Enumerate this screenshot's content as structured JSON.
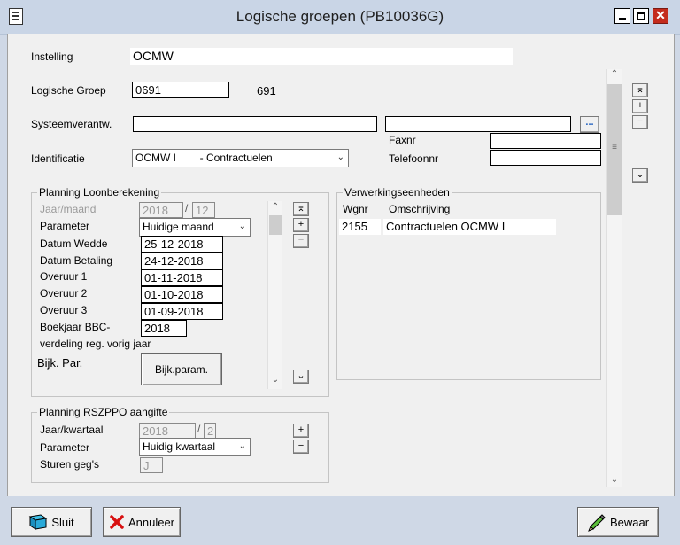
{
  "window": {
    "title": "Logische groepen (PB10036G)",
    "close_glyph": "✕"
  },
  "form": {
    "instelling_label": "Instelling",
    "instelling_value": "OCMW",
    "groep_label": "Logische Groep",
    "groep_value": "0691",
    "groep_code": "691",
    "systeem_label": "Systeemverantw.",
    "systeem_value1": "",
    "systeem_value2": "",
    "ellipsis": "...",
    "faxnr_label": "Faxnr",
    "faxnr_value": "",
    "telefoon_label": "Telefoonnr",
    "telefoon_value": "",
    "ident_label": "Identificatie",
    "ident_value": "OCMW I        - Contractuelen"
  },
  "planning": {
    "title": "Planning Loonberekening",
    "jaar_label": "Jaar/maand",
    "jaar_value": "2018",
    "maand_value": "12",
    "slash": "/",
    "parameter_label": "Parameter",
    "parameter_value": "Huidige maand",
    "rows": [
      {
        "label": "Datum Wedde",
        "value": "25-12-2018"
      },
      {
        "label": "Datum Betaling",
        "value": "24-12-2018"
      },
      {
        "label": "Overuur 1",
        "value": "01-11-2018"
      },
      {
        "label": "Overuur 2",
        "value": "01-10-2018"
      },
      {
        "label": "Overuur 3",
        "value": "01-09-2018"
      }
    ],
    "boekjaar_label": "Boekjaar BBC-",
    "boekjaar_value": "2018",
    "verdeling_label": "verdeling reg. vorig jaar",
    "bijk_label": "Bijk. Par.",
    "bijk_button": "Bijk.param."
  },
  "verwerking": {
    "title": "Verwerkingseenheden",
    "col_wgnr": "Wgnr",
    "col_omschrijving": "Omschrijving",
    "rows": [
      {
        "wgnr": "2155",
        "omschrijving": "Contractuelen OCMW I"
      }
    ]
  },
  "rszppo": {
    "title": "Planning RSZPPO aangifte",
    "jaar_label": "Jaar/kwartaal",
    "jaar_value": "2018",
    "kwartaal_value": "2",
    "slash": "/",
    "parameter_label": "Parameter",
    "parameter_value": "Huidig kwartaal",
    "sturen_label": "Sturen geg's",
    "sturen_value": "J"
  },
  "buttons": {
    "sluit": "Sluit",
    "annuleer": "Annuleer",
    "bewaar": "Bewaar"
  },
  "glyphs": {
    "first": "⌅",
    "plus": "+",
    "minus": "−",
    "last": "⌄",
    "up": "⌃",
    "down": "⌄",
    "grip": "≡",
    "chevron": "⌄"
  }
}
